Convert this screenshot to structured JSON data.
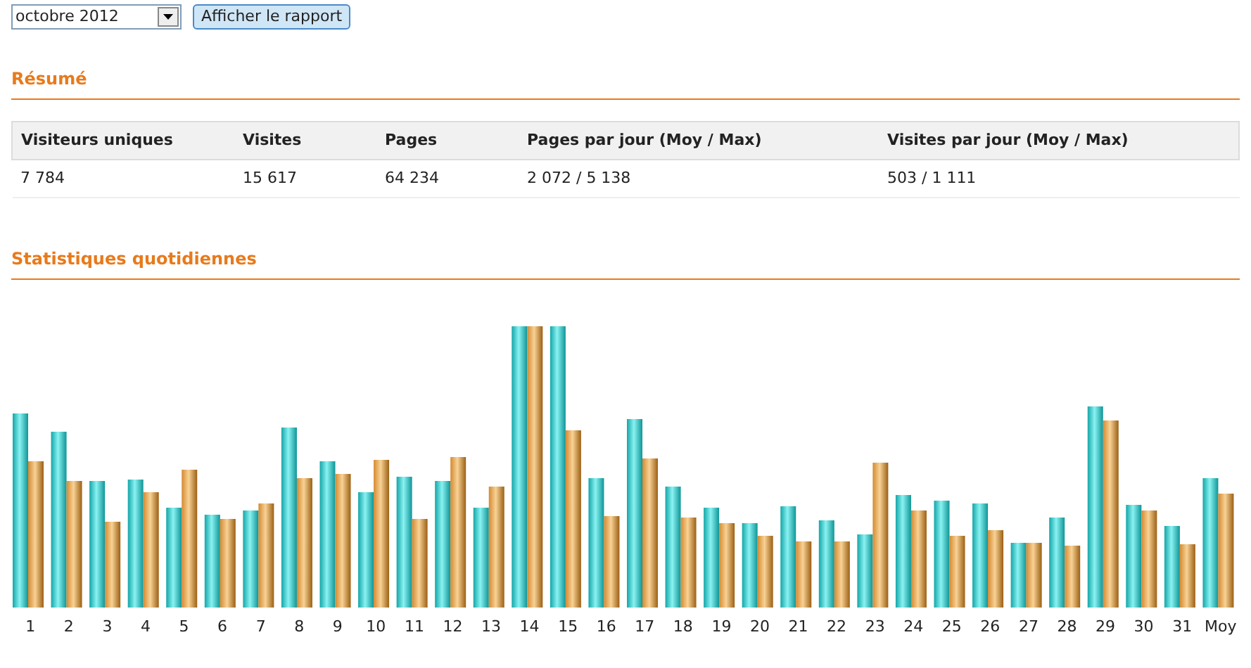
{
  "month_select": {
    "value": "octobre 2012"
  },
  "report_button": {
    "label": "Afficher le rapport"
  },
  "summary": {
    "title": "Résumé",
    "columns": [
      "Visiteurs uniques",
      "Visites",
      "Pages",
      "Pages par jour (Moy / Max)",
      "Visites par jour (Moy / Max)"
    ],
    "rows": [
      [
        "7 784",
        "15 617",
        "64 234",
        "2 072 / 5 138",
        "503 / 1 111"
      ]
    ]
  },
  "daily": {
    "title": "Statistiques quotidiennes",
    "categories": [
      "1",
      "2",
      "3",
      "4",
      "5",
      "6",
      "7",
      "8",
      "9",
      "10",
      "11",
      "12",
      "13",
      "14",
      "15",
      "16",
      "17",
      "18",
      "19",
      "20",
      "21",
      "22",
      "23",
      "24",
      "25",
      "26",
      "27",
      "28",
      "29",
      "30",
      "31",
      "Moy"
    ]
  }
}
